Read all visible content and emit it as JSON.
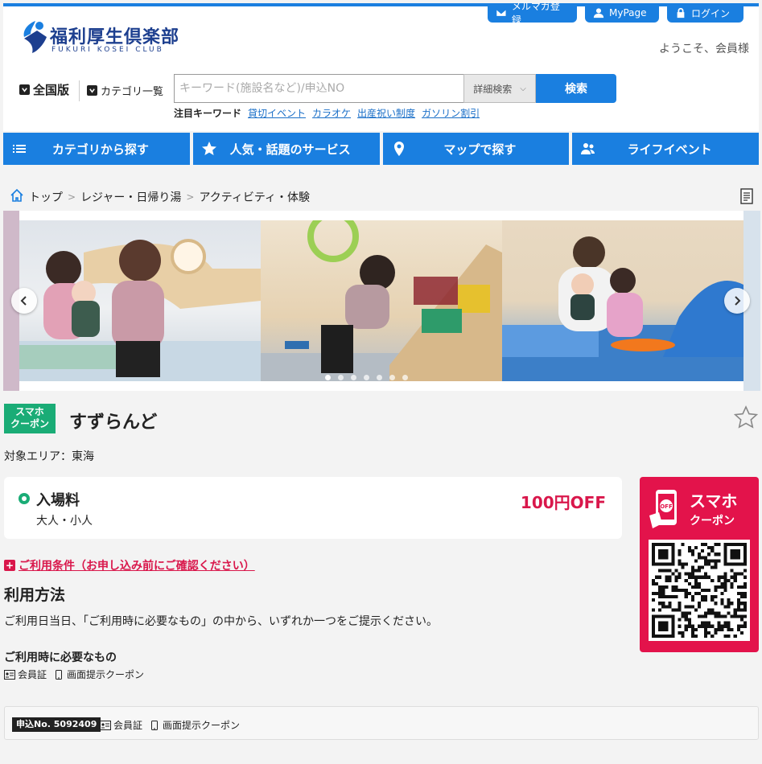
{
  "header": {
    "logo_jp": "福利厚生倶楽部",
    "logo_en": "FUKURI KOSEI CLUB",
    "mail_label": "メルマガ登録",
    "mypage_label": "MyPage",
    "login_label": "ログイン",
    "welcome": "ようこそ、会員様",
    "area_label": "全国版",
    "category_label": "カテゴリ一覧",
    "search_placeholder": "キーワード(施設名など)/申込NO",
    "detail_search": "詳細検索",
    "search_button": "検索",
    "keywords_label": "注目キーワード",
    "keywords": [
      "貸切イベント",
      "カラオケ",
      "出産祝い制度",
      "ガソリン割引"
    ]
  },
  "nav": {
    "items": [
      {
        "label": "カテゴリから探す",
        "icon": "list-icon"
      },
      {
        "label": "人気・話題のサービス",
        "icon": "star-icon"
      },
      {
        "label": "マップで探す",
        "icon": "map-pin-icon"
      },
      {
        "label": "ライフイベント",
        "icon": "people-icon"
      }
    ]
  },
  "breadcrumb": {
    "items": [
      "トップ",
      "レジャー・日帰り湯",
      "アクティビティ・体験"
    ]
  },
  "carousel": {
    "dot_count": 7,
    "active_dot": 0
  },
  "facility": {
    "badge": "スマホ\nクーポン",
    "badge_line1": "スマホ",
    "badge_line2": "クーポン",
    "name": "すずらんど",
    "area": "対象エリア：東海"
  },
  "price": {
    "label": "入場料",
    "sub": "大人・小人",
    "value": "100円OFF"
  },
  "coupon": {
    "title1": "スマホ",
    "title2": "クーポン",
    "phone_badge": "OFF"
  },
  "conditions": {
    "link": "ご利用条件（お申し込み前にご確認ください）"
  },
  "usage": {
    "heading": "利用方法",
    "text": "ご利用日当日、「ご利用時に必要なもの」の中から、いずれか一つをご提示ください。",
    "need_heading": "ご利用時に必要なもの",
    "items": [
      "会員証",
      "画面提示クーポン"
    ]
  },
  "apply": {
    "number": "申込No. 5092409",
    "items": [
      "会員証",
      "画面提示クーポン"
    ]
  },
  "colors": {
    "primary": "#1a7fe0",
    "accent_red": "#d9174b",
    "coupon_green": "#1aac76"
  }
}
